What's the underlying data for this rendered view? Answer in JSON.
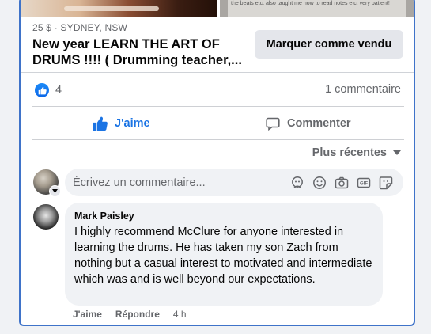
{
  "listing": {
    "price_location": "25 $ · SYDNEY, NSW",
    "title_line1": "New year LEARN THE ART OF",
    "title_line2": "DRUMS !!!! ( Drumming teacher,...",
    "mark_sold_label": "Marquer comme vendu",
    "photo_note": "the beats etc. also taught me how to read notes etc. very patient!"
  },
  "engagement": {
    "reaction_icon": "like-icon",
    "reaction_count": "4",
    "comment_count": "1 commentaire"
  },
  "actions": {
    "like_label": "J'aime",
    "comment_label": "Commenter"
  },
  "sort": {
    "label": "Plus récentes"
  },
  "composer": {
    "placeholder": "Écrivez un commentaire...",
    "icons": [
      "avatar-sticker-icon",
      "emoji-icon",
      "camera-icon",
      "gif-icon",
      "sticker-icon"
    ]
  },
  "comment": {
    "author": "Mark Paisley",
    "text": "I highly recommend McClure for anyone interested in learning the drums. He has taken my son Zach from nothing but a casual interest to motivated and intermediate which was and is well beyond our expectations.",
    "like_label": "J'aime",
    "reply_label": "Répondre",
    "time": "4 h"
  },
  "colors": {
    "accent": "#1b74e4",
    "card_border": "#3f73c9",
    "secondary_text": "#65676b",
    "bubble_bg": "#f0f2f5"
  }
}
